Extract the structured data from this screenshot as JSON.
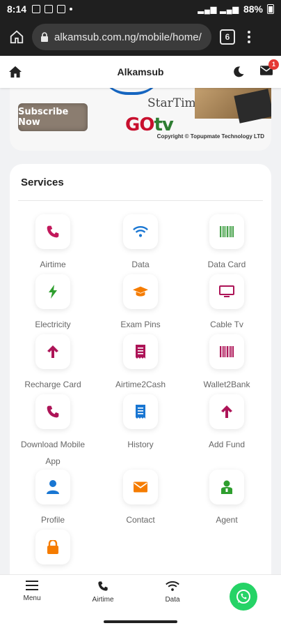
{
  "statusbar": {
    "time": "8:14",
    "battery": "88%"
  },
  "browser": {
    "url": "alkamsub.com.ng/mobile/home/",
    "tab_count": "6"
  },
  "app": {
    "title": "Alkamsub",
    "notification_count": "1"
  },
  "banner": {
    "button_label": "Subscribe Now",
    "brand_1": "StarTimes",
    "brand_2_a": "GO",
    "brand_2_b": "tv",
    "copyright": "Copyright © Topupmate Technology LTD"
  },
  "services": {
    "title": "Services",
    "items": [
      {
        "label": "Airtime",
        "icon": "phone-icon",
        "color": "#c2185b"
      },
      {
        "label": "Data",
        "icon": "wifi-icon",
        "color": "#1976d2"
      },
      {
        "label": "Data Card",
        "icon": "barcode-icon",
        "color": "#43a047"
      },
      {
        "label": "Electricity",
        "icon": "bolt-icon",
        "color": "#2e9e2e"
      },
      {
        "label": "Exam Pins",
        "icon": "graduation-cap-icon",
        "color": "#f57c00"
      },
      {
        "label": "Cable Tv",
        "icon": "tv-icon",
        "color": "#ad1457"
      },
      {
        "label": "Recharge Card",
        "icon": "arrow-up-icon",
        "color": "#ad1457"
      },
      {
        "label": "Airtime2Cash",
        "icon": "receipt-icon",
        "color": "#ad1457"
      },
      {
        "label": "Wallet2Bank",
        "icon": "barcode-icon",
        "color": "#ad1457"
      },
      {
        "label": "Download Mobile App",
        "icon": "phone-icon",
        "color": "#ad1457"
      },
      {
        "label": "History",
        "icon": "receipt-icon",
        "color": "#1976d2"
      },
      {
        "label": "Add Fund",
        "icon": "arrow-up-icon",
        "color": "#ad1457"
      },
      {
        "label": "Profile",
        "icon": "user-icon",
        "color": "#1976d2"
      },
      {
        "label": "Contact",
        "icon": "envelope-icon",
        "color": "#f57c00"
      },
      {
        "label": "Agent",
        "icon": "agent-icon",
        "color": "#2e9e2e"
      },
      {
        "label": "",
        "icon": "lock-icon",
        "color": "#f57c00"
      }
    ]
  },
  "bottom_nav": {
    "menu": "Menu",
    "airtime": "Airtime",
    "data": "Data"
  }
}
